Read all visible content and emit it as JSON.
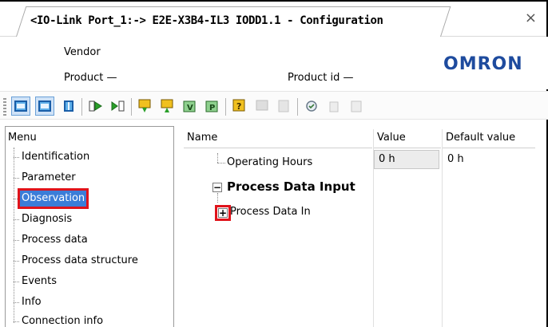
{
  "window": {
    "title": "<IO-Link Port_1:-> E2E-X3B4-IL3 IODD1.1 - Configuration",
    "close_glyph": "×"
  },
  "header": {
    "vendor_label": "Vendor",
    "product_label": "Product —",
    "product_id_label": "Product id —",
    "logo_text": "OMRON",
    "logo_color": "#1e4b9e"
  },
  "toolbar": {
    "buttons": [
      {
        "icon": "window-layout-icon",
        "active": true
      },
      {
        "icon": "window-layout-alt-icon",
        "active": true
      },
      {
        "icon": "panel-layout-icon",
        "active": false
      },
      {
        "icon": "upload-device-icon",
        "active": false
      },
      {
        "icon": "download-device-icon",
        "active": false
      },
      {
        "icon": "read-parameters-icon",
        "active": false
      },
      {
        "icon": "write-parameters-icon",
        "active": false
      },
      {
        "icon": "validate-icon",
        "active": false
      },
      {
        "icon": "compare-icon",
        "active": false
      },
      {
        "icon": "help-data-icon",
        "active": false
      },
      {
        "icon": "restore-icon",
        "active": false
      },
      {
        "icon": "device-disabled-icon",
        "active": false
      },
      {
        "icon": "refresh-icon",
        "active": false
      },
      {
        "icon": "trash-icon",
        "active": false
      },
      {
        "icon": "store-icon",
        "active": false
      }
    ]
  },
  "sidebar": {
    "heading": "Menu",
    "items": [
      {
        "label": "Identification",
        "selected": false
      },
      {
        "label": "Parameter",
        "selected": false
      },
      {
        "label": "Observation",
        "selected": true
      },
      {
        "label": "Diagnosis",
        "selected": false
      },
      {
        "label": "Process data",
        "selected": false
      },
      {
        "label": "Process data structure",
        "selected": false
      },
      {
        "label": "Events",
        "selected": false
      },
      {
        "label": "Info",
        "selected": false
      },
      {
        "label": "Connection info",
        "selected": false
      }
    ],
    "highlight_color": "#e0131b",
    "selection_color": "#3b7dd8"
  },
  "table": {
    "columns": [
      "Name",
      "Value",
      "Default value"
    ],
    "rows": [
      {
        "name": "Operating Hours",
        "value": "0 h",
        "default": "0 h"
      },
      {
        "name": "Process Data Input",
        "value": "",
        "default": ""
      },
      {
        "name": "Process Data In",
        "value": "",
        "default": ""
      }
    ],
    "collapse_glyph": "−",
    "expand_glyph": "+"
  }
}
